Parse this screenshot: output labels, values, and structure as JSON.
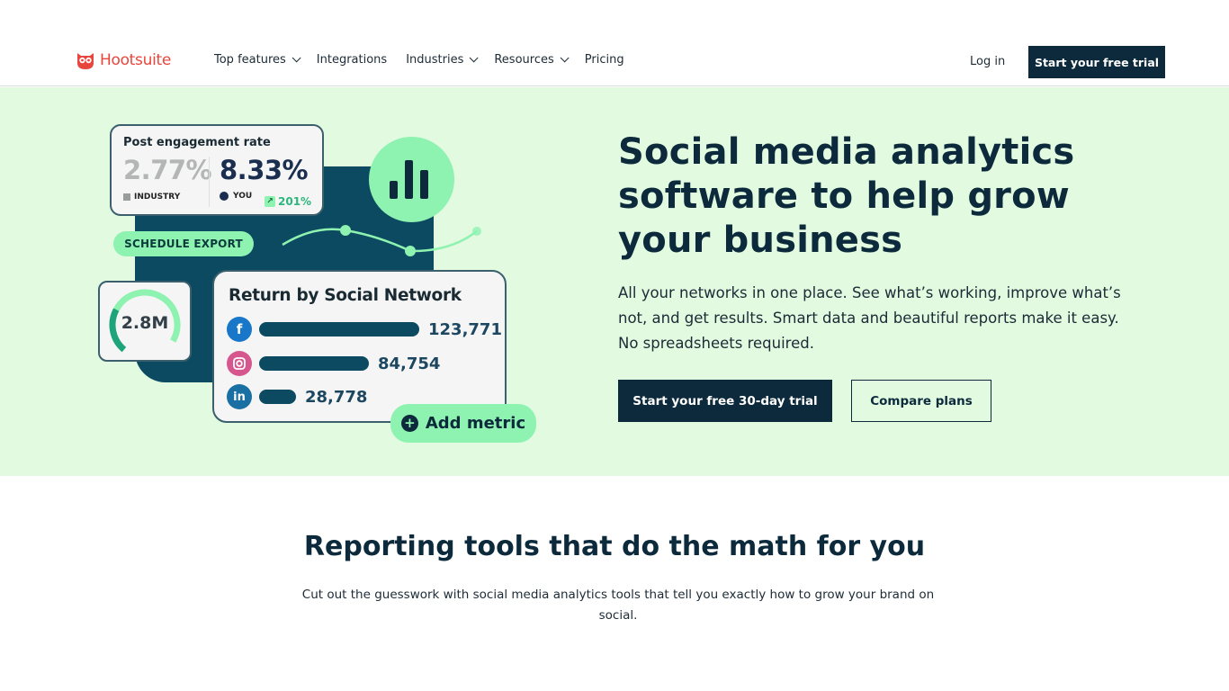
{
  "header": {
    "logo_text": "Hootsuite",
    "nav": [
      {
        "label": "Top features",
        "has_dropdown": true
      },
      {
        "label": "Integrations",
        "has_dropdown": false
      },
      {
        "label": "Industries",
        "has_dropdown": true
      },
      {
        "label": "Resources",
        "has_dropdown": true
      },
      {
        "label": "Pricing",
        "has_dropdown": false
      }
    ],
    "login_label": "Log in",
    "cta_label": "Start your free trial"
  },
  "hero": {
    "headline": "Social media analytics software to help grow your business",
    "subtext": "All your networks in one place. See what’s working, improve what’s not, and get results. Smart data and beautiful reports make it easy. No spreadsheets required.",
    "primary_cta": "Start your free 30-day trial",
    "secondary_cta": "Compare plans",
    "illustration": {
      "engagement": {
        "title": "Post engagement rate",
        "industry_value": "2.77%",
        "industry_label": "INDUSTRY",
        "you_value": "8.33%",
        "you_label": "YOU",
        "growth": "201%"
      },
      "schedule_export": "SCHEDULE EXPORT",
      "gauge": {
        "value": "2.8M",
        "fill_fraction": 0.3
      },
      "return_card": {
        "title": "Return by Social Network",
        "rows": [
          {
            "network": "facebook",
            "value": "123,771",
            "amount": 123771
          },
          {
            "network": "instagram",
            "value": "84,754",
            "amount": 84754
          },
          {
            "network": "linkedin",
            "value": "28,778",
            "amount": 28778
          }
        ]
      },
      "add_metric": "Add metric"
    }
  },
  "section": {
    "title": "Reporting tools that do the math for you",
    "subtitle": "Cut out the guesswork with social media analytics tools that tell you exactly how to grow your brand on social."
  },
  "colors": {
    "brand_dark": "#0c2a3b",
    "hero_bg": "#e1fae0",
    "accent_green": "#8ef2b0",
    "logo_red": "#e8453c"
  }
}
